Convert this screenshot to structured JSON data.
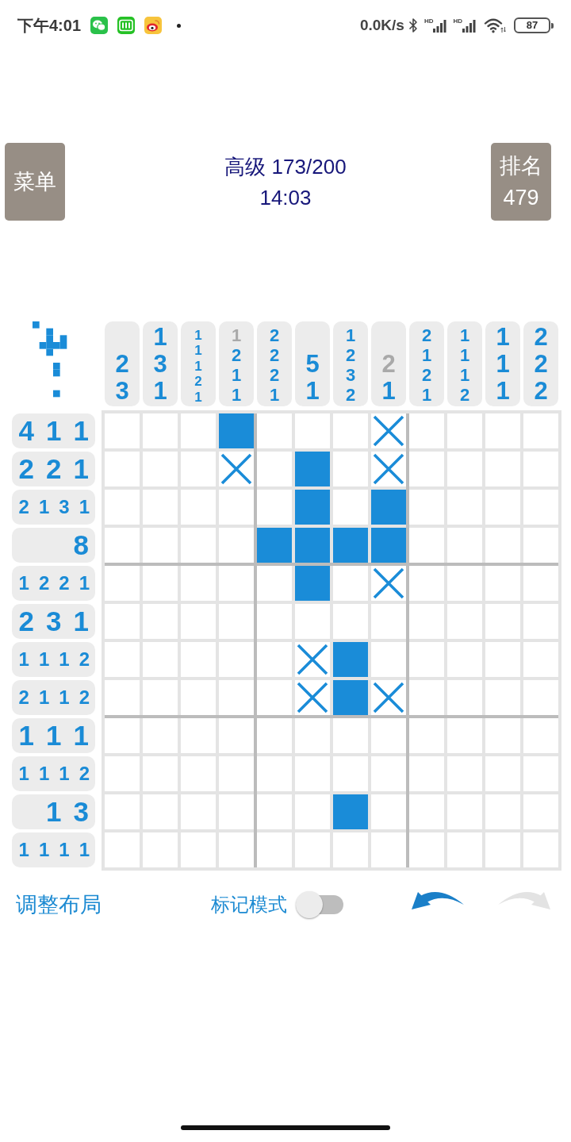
{
  "status_bar": {
    "time": "下午4:01",
    "net_speed": "0.0K/s",
    "signals": [
      {
        "label": "HD"
      },
      {
        "label": "HD"
      }
    ],
    "battery": "87"
  },
  "header": {
    "menu_button": "菜单",
    "title": "高级 173/200",
    "timer": "14:03",
    "rank_button": {
      "label": "排名",
      "value": "479"
    }
  },
  "puzzle": {
    "columns": [
      {
        "clues": [
          {
            "value": "2",
            "done": false
          },
          {
            "value": "3",
            "done": false
          }
        ]
      },
      {
        "clues": [
          {
            "value": "1",
            "done": false
          },
          {
            "value": "3",
            "done": false
          },
          {
            "value": "1",
            "done": false
          }
        ]
      },
      {
        "clues": [
          {
            "value": "1",
            "done": false
          },
          {
            "value": "1",
            "done": false
          },
          {
            "value": "1",
            "done": false
          },
          {
            "value": "2",
            "done": false
          },
          {
            "value": "1",
            "done": false
          }
        ]
      },
      {
        "clues": [
          {
            "value": "1",
            "done": true
          },
          {
            "value": "2",
            "done": false
          },
          {
            "value": "1",
            "done": false
          },
          {
            "value": "1",
            "done": false
          }
        ]
      },
      {
        "clues": [
          {
            "value": "2",
            "done": false
          },
          {
            "value": "2",
            "done": false
          },
          {
            "value": "2",
            "done": false
          },
          {
            "value": "1",
            "done": false
          }
        ]
      },
      {
        "clues": [
          {
            "value": "5",
            "done": false
          },
          {
            "value": "1",
            "done": false
          }
        ]
      },
      {
        "clues": [
          {
            "value": "1",
            "done": false
          },
          {
            "value": "2",
            "done": false
          },
          {
            "value": "3",
            "done": false
          },
          {
            "value": "2",
            "done": false
          }
        ]
      },
      {
        "clues": [
          {
            "value": "2",
            "done": true
          },
          {
            "value": "1",
            "done": false
          }
        ]
      },
      {
        "clues": [
          {
            "value": "2",
            "done": false
          },
          {
            "value": "1",
            "done": false
          },
          {
            "value": "2",
            "done": false
          },
          {
            "value": "1",
            "done": false
          }
        ]
      },
      {
        "clues": [
          {
            "value": "1",
            "done": false
          },
          {
            "value": "1",
            "done": false
          },
          {
            "value": "1",
            "done": false
          },
          {
            "value": "2",
            "done": false
          }
        ]
      },
      {
        "clues": [
          {
            "value": "1",
            "done": false
          },
          {
            "value": "1",
            "done": false
          },
          {
            "value": "1",
            "done": false
          }
        ]
      },
      {
        "clues": [
          {
            "value": "2",
            "done": false
          },
          {
            "value": "2",
            "done": false
          },
          {
            "value": "2",
            "done": false
          }
        ]
      }
    ],
    "rows": [
      {
        "clues": [
          {
            "value": "4",
            "done": false
          },
          {
            "value": "1",
            "done": false
          },
          {
            "value": "1",
            "done": false
          }
        ],
        "cells": [
          {
            "filled": false,
            "crossed": false
          },
          {
            "filled": false,
            "crossed": false
          },
          {
            "filled": false,
            "crossed": false
          },
          {
            "filled": true,
            "crossed": false
          },
          {
            "filled": false,
            "crossed": false
          },
          {
            "filled": false,
            "crossed": false
          },
          {
            "filled": false,
            "crossed": false
          },
          {
            "filled": false,
            "crossed": true
          },
          {
            "filled": false,
            "crossed": false
          },
          {
            "filled": false,
            "crossed": false
          },
          {
            "filled": false,
            "crossed": false
          },
          {
            "filled": false,
            "crossed": false
          }
        ]
      },
      {
        "clues": [
          {
            "value": "2",
            "done": false
          },
          {
            "value": "2",
            "done": false
          },
          {
            "value": "1",
            "done": false
          }
        ],
        "cells": [
          {
            "filled": false,
            "crossed": false
          },
          {
            "filled": false,
            "crossed": false
          },
          {
            "filled": false,
            "crossed": false
          },
          {
            "filled": false,
            "crossed": true
          },
          {
            "filled": false,
            "crossed": false
          },
          {
            "filled": true,
            "crossed": false
          },
          {
            "filled": false,
            "crossed": false
          },
          {
            "filled": false,
            "crossed": true
          },
          {
            "filled": false,
            "crossed": false
          },
          {
            "filled": false,
            "crossed": false
          },
          {
            "filled": false,
            "crossed": false
          },
          {
            "filled": false,
            "crossed": false
          }
        ]
      },
      {
        "clues": [
          {
            "value": "2",
            "done": false
          },
          {
            "value": "1",
            "done": false
          },
          {
            "value": "3",
            "done": false
          },
          {
            "value": "1",
            "done": false
          }
        ],
        "cells": [
          {
            "filled": false,
            "crossed": false
          },
          {
            "filled": false,
            "crossed": false
          },
          {
            "filled": false,
            "crossed": false
          },
          {
            "filled": false,
            "crossed": false
          },
          {
            "filled": false,
            "crossed": false
          },
          {
            "filled": true,
            "crossed": false
          },
          {
            "filled": false,
            "crossed": false
          },
          {
            "filled": true,
            "crossed": false
          },
          {
            "filled": false,
            "crossed": false
          },
          {
            "filled": false,
            "crossed": false
          },
          {
            "filled": false,
            "crossed": false
          },
          {
            "filled": false,
            "crossed": false
          }
        ]
      },
      {
        "clues": [
          {
            "value": "8",
            "done": false
          }
        ],
        "cells": [
          {
            "filled": false,
            "crossed": false
          },
          {
            "filled": false,
            "crossed": false
          },
          {
            "filled": false,
            "crossed": false
          },
          {
            "filled": false,
            "crossed": false
          },
          {
            "filled": true,
            "crossed": false
          },
          {
            "filled": true,
            "crossed": false
          },
          {
            "filled": true,
            "crossed": false
          },
          {
            "filled": true,
            "crossed": false
          },
          {
            "filled": false,
            "crossed": false
          },
          {
            "filled": false,
            "crossed": false
          },
          {
            "filled": false,
            "crossed": false
          },
          {
            "filled": false,
            "crossed": false
          }
        ]
      },
      {
        "clues": [
          {
            "value": "1",
            "done": false
          },
          {
            "value": "2",
            "done": false
          },
          {
            "value": "2",
            "done": false
          },
          {
            "value": "1",
            "done": false
          }
        ],
        "cells": [
          {
            "filled": false,
            "crossed": false
          },
          {
            "filled": false,
            "crossed": false
          },
          {
            "filled": false,
            "crossed": false
          },
          {
            "filled": false,
            "crossed": false
          },
          {
            "filled": false,
            "crossed": false
          },
          {
            "filled": true,
            "crossed": false
          },
          {
            "filled": false,
            "crossed": false
          },
          {
            "filled": false,
            "crossed": true
          },
          {
            "filled": false,
            "crossed": false
          },
          {
            "filled": false,
            "crossed": false
          },
          {
            "filled": false,
            "crossed": false
          },
          {
            "filled": false,
            "crossed": false
          }
        ]
      },
      {
        "clues": [
          {
            "value": "2",
            "done": false
          },
          {
            "value": "3",
            "done": false
          },
          {
            "value": "1",
            "done": false
          }
        ],
        "cells": [
          {
            "filled": false,
            "crossed": false
          },
          {
            "filled": false,
            "crossed": false
          },
          {
            "filled": false,
            "crossed": false
          },
          {
            "filled": false,
            "crossed": false
          },
          {
            "filled": false,
            "crossed": false
          },
          {
            "filled": false,
            "crossed": false
          },
          {
            "filled": false,
            "crossed": false
          },
          {
            "filled": false,
            "crossed": false
          },
          {
            "filled": false,
            "crossed": false
          },
          {
            "filled": false,
            "crossed": false
          },
          {
            "filled": false,
            "crossed": false
          },
          {
            "filled": false,
            "crossed": false
          }
        ]
      },
      {
        "clues": [
          {
            "value": "1",
            "done": false
          },
          {
            "value": "1",
            "done": false
          },
          {
            "value": "1",
            "done": false
          },
          {
            "value": "2",
            "done": false
          }
        ],
        "cells": [
          {
            "filled": false,
            "crossed": false
          },
          {
            "filled": false,
            "crossed": false
          },
          {
            "filled": false,
            "crossed": false
          },
          {
            "filled": false,
            "crossed": false
          },
          {
            "filled": false,
            "crossed": false
          },
          {
            "filled": false,
            "crossed": true
          },
          {
            "filled": true,
            "crossed": false
          },
          {
            "filled": false,
            "crossed": false
          },
          {
            "filled": false,
            "crossed": false
          },
          {
            "filled": false,
            "crossed": false
          },
          {
            "filled": false,
            "crossed": false
          },
          {
            "filled": false,
            "crossed": false
          }
        ]
      },
      {
        "clues": [
          {
            "value": "2",
            "done": false
          },
          {
            "value": "1",
            "done": false
          },
          {
            "value": "1",
            "done": false
          },
          {
            "value": "2",
            "done": false
          }
        ],
        "cells": [
          {
            "filled": false,
            "crossed": false
          },
          {
            "filled": false,
            "crossed": false
          },
          {
            "filled": false,
            "crossed": false
          },
          {
            "filled": false,
            "crossed": false
          },
          {
            "filled": false,
            "crossed": false
          },
          {
            "filled": false,
            "crossed": true
          },
          {
            "filled": true,
            "crossed": false
          },
          {
            "filled": false,
            "crossed": true
          },
          {
            "filled": false,
            "crossed": false
          },
          {
            "filled": false,
            "crossed": false
          },
          {
            "filled": false,
            "crossed": false
          },
          {
            "filled": false,
            "crossed": false
          }
        ]
      },
      {
        "clues": [
          {
            "value": "1",
            "done": false
          },
          {
            "value": "1",
            "done": false
          },
          {
            "value": "1",
            "done": false
          }
        ],
        "cells": [
          {
            "filled": false,
            "crossed": false
          },
          {
            "filled": false,
            "crossed": false
          },
          {
            "filled": false,
            "crossed": false
          },
          {
            "filled": false,
            "crossed": false
          },
          {
            "filled": false,
            "crossed": false
          },
          {
            "filled": false,
            "crossed": false
          },
          {
            "filled": false,
            "crossed": false
          },
          {
            "filled": false,
            "crossed": false
          },
          {
            "filled": false,
            "crossed": false
          },
          {
            "filled": false,
            "crossed": false
          },
          {
            "filled": false,
            "crossed": false
          },
          {
            "filled": false,
            "crossed": false
          }
        ]
      },
      {
        "clues": [
          {
            "value": "1",
            "done": false
          },
          {
            "value": "1",
            "done": false
          },
          {
            "value": "1",
            "done": false
          },
          {
            "value": "2",
            "done": false
          }
        ],
        "cells": [
          {
            "filled": false,
            "crossed": false
          },
          {
            "filled": false,
            "crossed": false
          },
          {
            "filled": false,
            "crossed": false
          },
          {
            "filled": false,
            "crossed": false
          },
          {
            "filled": false,
            "crossed": false
          },
          {
            "filled": false,
            "crossed": false
          },
          {
            "filled": false,
            "crossed": false
          },
          {
            "filled": false,
            "crossed": false
          },
          {
            "filled": false,
            "crossed": false
          },
          {
            "filled": false,
            "crossed": false
          },
          {
            "filled": false,
            "crossed": false
          },
          {
            "filled": false,
            "crossed": false
          }
        ]
      },
      {
        "clues": [
          {
            "value": "1",
            "done": false
          },
          {
            "value": "3",
            "done": false
          }
        ],
        "cells": [
          {
            "filled": false,
            "crossed": false
          },
          {
            "filled": false,
            "crossed": false
          },
          {
            "filled": false,
            "crossed": false
          },
          {
            "filled": false,
            "crossed": false
          },
          {
            "filled": false,
            "crossed": false
          },
          {
            "filled": false,
            "crossed": false
          },
          {
            "filled": true,
            "crossed": false
          },
          {
            "filled": false,
            "crossed": false
          },
          {
            "filled": false,
            "crossed": false
          },
          {
            "filled": false,
            "crossed": false
          },
          {
            "filled": false,
            "crossed": false
          },
          {
            "filled": false,
            "crossed": false
          }
        ]
      },
      {
        "clues": [
          {
            "value": "1",
            "done": false
          },
          {
            "value": "1",
            "done": false
          },
          {
            "value": "1",
            "done": false
          },
          {
            "value": "1",
            "done": false
          }
        ],
        "cells": [
          {
            "filled": false,
            "crossed": false
          },
          {
            "filled": false,
            "crossed": false
          },
          {
            "filled": false,
            "crossed": false
          },
          {
            "filled": false,
            "crossed": false
          },
          {
            "filled": false,
            "crossed": false
          },
          {
            "filled": false,
            "crossed": false
          },
          {
            "filled": false,
            "crossed": false
          },
          {
            "filled": false,
            "crossed": false
          },
          {
            "filled": false,
            "crossed": false
          },
          {
            "filled": false,
            "crossed": false
          },
          {
            "filled": false,
            "crossed": false
          },
          {
            "filled": false,
            "crossed": false
          }
        ]
      }
    ]
  },
  "controls": {
    "layout_button": "调整布局",
    "mark_mode": {
      "label": "标记模式",
      "on": false
    },
    "undo": {
      "disabled": false
    },
    "redo": {
      "disabled": true
    }
  }
}
